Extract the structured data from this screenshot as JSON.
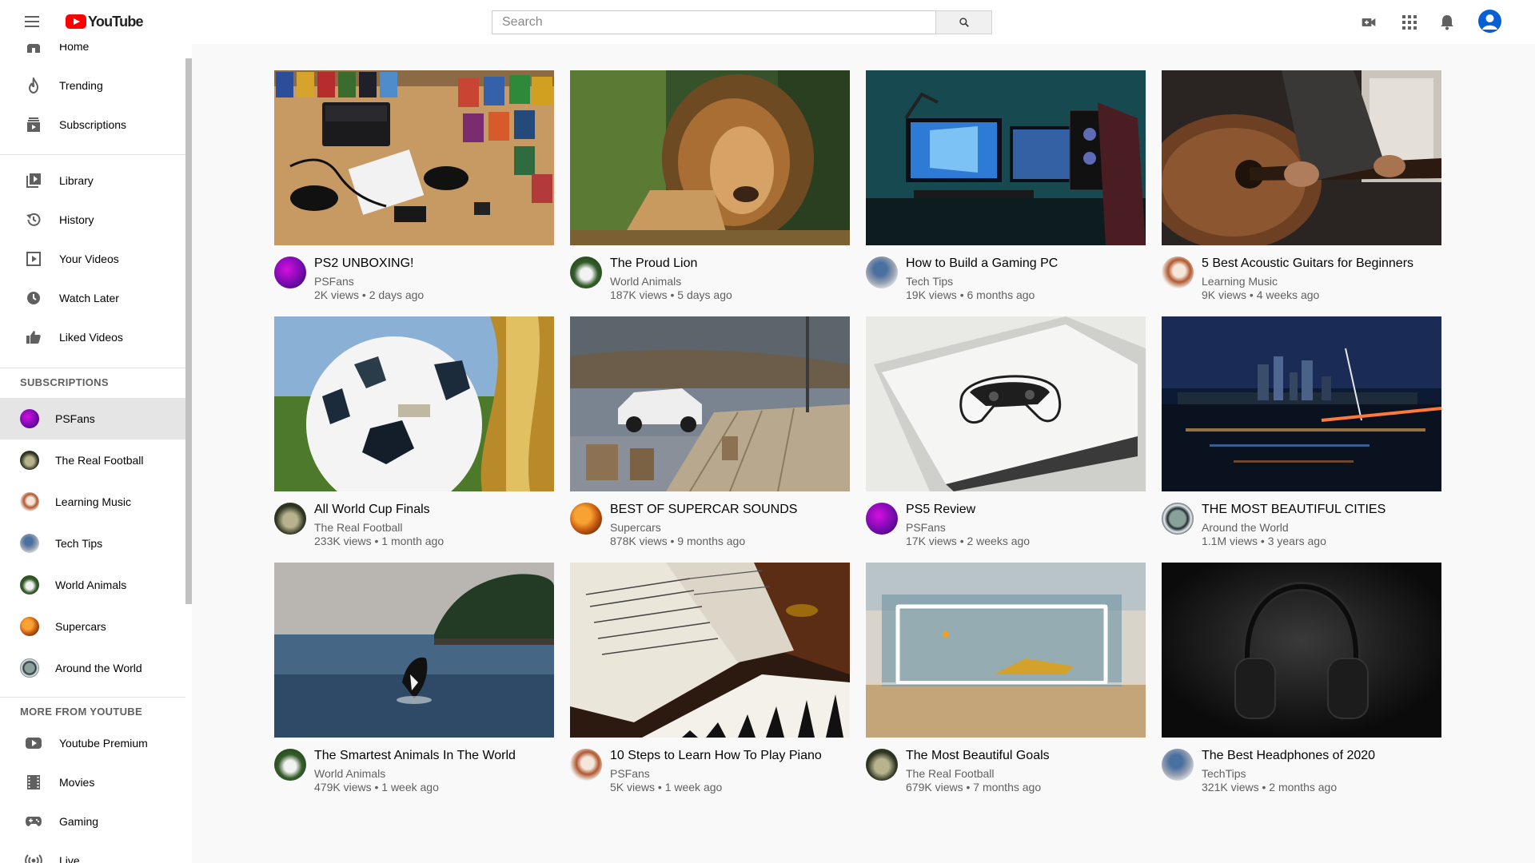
{
  "header": {
    "logo_text": "YouTube",
    "search_placeholder": "Search",
    "brand_color": "#ff0000",
    "accent_color": "#065fd4",
    "icons": [
      "menu-icon",
      "search-icon",
      "create-video-icon",
      "apps-grid-icon",
      "notifications-bell-icon",
      "account-avatar-icon"
    ]
  },
  "sidebar": {
    "main_items": [
      {
        "label": "Home",
        "icon": "home-icon"
      },
      {
        "label": "Trending",
        "icon": "flame-icon"
      },
      {
        "label": "Subscriptions",
        "icon": "subscriptions-icon"
      }
    ],
    "library_items": [
      {
        "label": "Library",
        "icon": "library-icon"
      },
      {
        "label": "History",
        "icon": "history-icon"
      },
      {
        "label": "Your Videos",
        "icon": "play-square-icon"
      },
      {
        "label": "Watch Later",
        "icon": "clock-icon"
      },
      {
        "label": "Liked Videos",
        "icon": "thumbs-up-icon"
      }
    ],
    "subscriptions_heading": "SUBSCRIPTIONS",
    "subscriptions": [
      {
        "label": "PSFans",
        "active": true
      },
      {
        "label": "The Real Football"
      },
      {
        "label": "Learning Music"
      },
      {
        "label": "Tech Tips"
      },
      {
        "label": "World Animals"
      },
      {
        "label": "Supercars"
      },
      {
        "label": "Around the World"
      }
    ],
    "more_heading": "MORE FROM YOUTUBE",
    "more_items": [
      {
        "label": "Youtube Premium",
        "icon": "youtube-premium-icon"
      },
      {
        "label": "Movies",
        "icon": "film-icon"
      },
      {
        "label": "Gaming",
        "icon": "gamepad-icon"
      },
      {
        "label": "Live",
        "icon": "live-broadcast-icon"
      }
    ]
  },
  "videos": [
    {
      "title": "PS2 UNBOXING!",
      "channel": "PSFans",
      "meta": "2K views • 2 days ago"
    },
    {
      "title": "The Proud Lion",
      "channel": "World Animals",
      "meta": "187K views • 5 days ago"
    },
    {
      "title": "How to Build a Gaming PC",
      "channel": "Tech Tips",
      "meta": "19K views • 6 months ago"
    },
    {
      "title": "5 Best Acoustic Guitars for Beginners",
      "channel": "Learning Music",
      "meta": "9K views • 4 weeks ago"
    },
    {
      "title": "All World Cup Finals",
      "channel": "The Real Football",
      "meta": "233K views • 1 month ago"
    },
    {
      "title": "BEST OF SUPERCAR SOUNDS",
      "channel": "Supercars",
      "meta": "878K views • 9 months ago"
    },
    {
      "title": "PS5 Review",
      "channel": "PSFans",
      "meta": "17K views • 2 weeks ago"
    },
    {
      "title": "THE MOST BEAUTIFUL CITIES",
      "channel": "Around the World",
      "meta": "1.1M views • 3 years ago"
    },
    {
      "title": "The Smartest Animals In The World",
      "channel": "World Animals",
      "meta": "479K views • 1 week ago"
    },
    {
      "title": "10 Steps to Learn How To Play Piano",
      "channel": "PSFans",
      "meta": "5K views • 1 week ago"
    },
    {
      "title": "The Most Beautiful Goals",
      "channel": "The Real Football",
      "meta": "679K views • 7 months ago"
    },
    {
      "title": "The Best Headphones of 2020",
      "channel": "TechTips",
      "meta": "321K views • 2 months ago"
    }
  ]
}
